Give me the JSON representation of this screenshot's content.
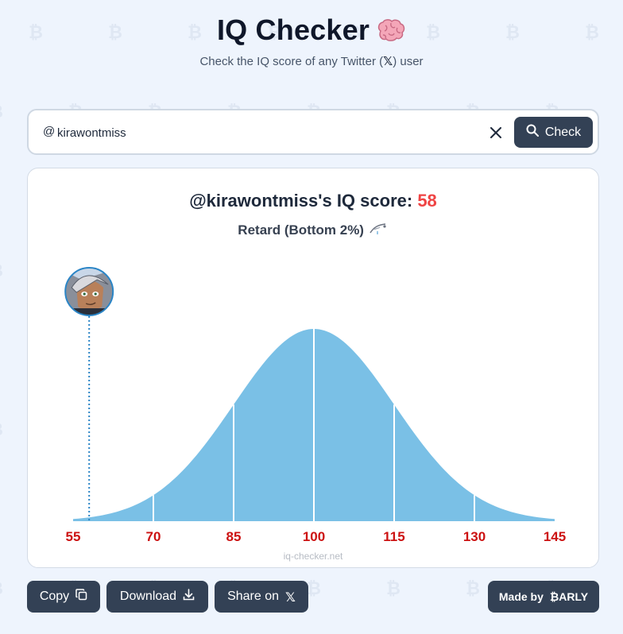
{
  "header": {
    "title": "IQ Checker",
    "title_icon": "brain-emoji",
    "subtitle_prefix": "Check the IQ score of any Twitter (",
    "subtitle_x": "𝕏",
    "subtitle_suffix": ") user"
  },
  "search": {
    "at_symbol": "@",
    "value": "kirawontmiss",
    "clear_icon": "close-icon",
    "check_label": "Check",
    "check_icon": "search-icon"
  },
  "result": {
    "title_prefix": "@kirawontmiss's IQ score: ",
    "score": "58",
    "label": "Retard (Bottom 2%)",
    "label_icon": "drool-emoji",
    "avatar": "user-avatar",
    "watermark": "iq-checker.net"
  },
  "chart_data": {
    "type": "area",
    "distribution": "normal",
    "mean": 100,
    "sd": 15,
    "x_ticks": [
      55,
      70,
      85,
      100,
      115,
      130,
      145
    ],
    "xlim": [
      55,
      145
    ],
    "marker_x": 58,
    "divider_lines_at": [
      70,
      85,
      100,
      115,
      130
    ],
    "fill_color": "#7ac0e6",
    "tick_color": "#cc1111",
    "marker_color": "#2b85c6"
  },
  "actions": {
    "copy_label": "Copy",
    "download_label": "Download",
    "share_label": "Share on",
    "share_icon": "𝕏",
    "made_by_label": "Made by",
    "made_by_brand": "₿ARLY"
  },
  "colors": {
    "accent_dark": "#334155",
    "score_red": "#ef4444",
    "background": "#eef4fd"
  }
}
